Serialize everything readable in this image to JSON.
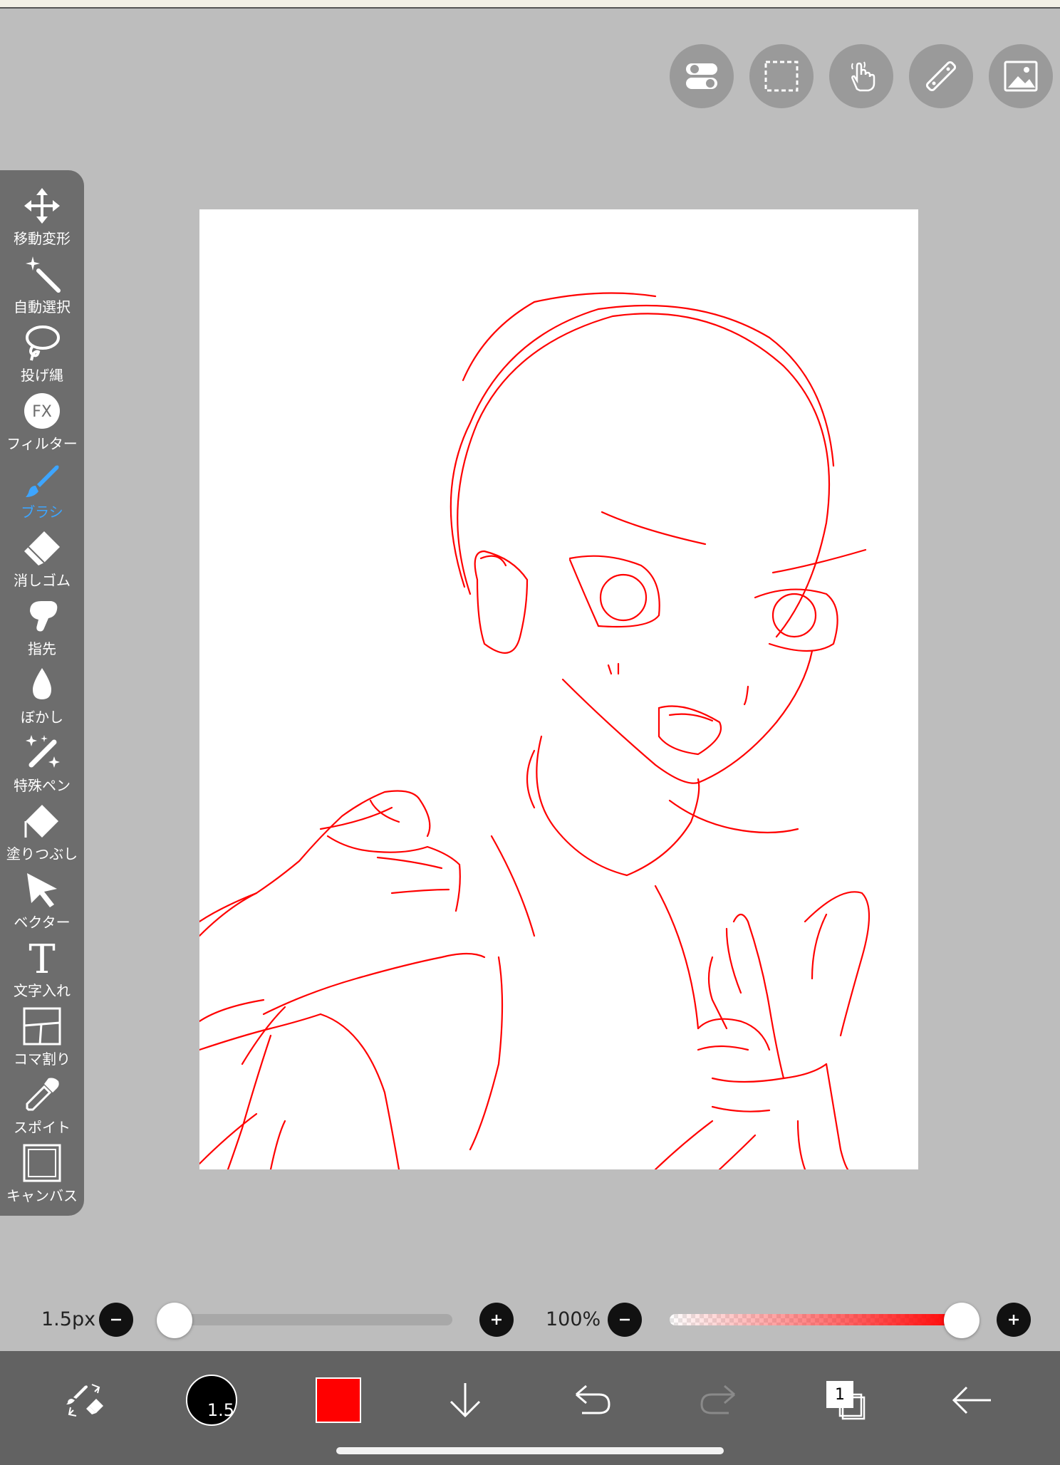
{
  "top_buttons": [
    {
      "name": "toggle-icon"
    },
    {
      "name": "selection-icon"
    },
    {
      "name": "hand-touch-icon"
    },
    {
      "name": "ruler-icon"
    },
    {
      "name": "image-icon"
    }
  ],
  "tools": [
    {
      "label": "移動変形",
      "icon": "move-icon"
    },
    {
      "label": "自動選択",
      "icon": "magic-wand-icon"
    },
    {
      "label": "投げ縄",
      "icon": "lasso-icon"
    },
    {
      "label": "フィルター",
      "icon": "fx-icon"
    },
    {
      "label": "ブラシ",
      "icon": "brush-icon",
      "active": true
    },
    {
      "label": "消しゴム",
      "icon": "eraser-icon"
    },
    {
      "label": "指先",
      "icon": "finger-icon"
    },
    {
      "label": "ぼかし",
      "icon": "blur-drop-icon"
    },
    {
      "label": "特殊ペン",
      "icon": "special-pen-icon"
    },
    {
      "label": "塗りつぶし",
      "icon": "fill-icon"
    },
    {
      "label": "ベクター",
      "icon": "vector-cursor-icon"
    },
    {
      "label": "文字入れ",
      "icon": "text-icon"
    },
    {
      "label": "コマ割り",
      "icon": "panel-icon"
    },
    {
      "label": "スポイト",
      "icon": "eyedropper-icon"
    },
    {
      "label": "キャンバス",
      "icon": "canvas-icon"
    }
  ],
  "brush_size": {
    "label": "1.5px",
    "value": 1.5,
    "slider_fraction": 0.0
  },
  "opacity": {
    "label": "100%",
    "value": 100,
    "slider_fraction": 1.0
  },
  "bottom_bar": {
    "brush_preview_label": "1.5",
    "color": "#ff0000",
    "layer_count": "1"
  },
  "colors": {
    "accent": "#3da5ff",
    "stroke": "#ff0000",
    "toolbar": "#6d6d6d",
    "background": "#bdbdbd"
  }
}
